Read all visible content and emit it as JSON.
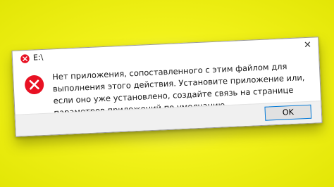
{
  "window": {
    "title": "E:\\",
    "close_glyph": "✕"
  },
  "icons": {
    "title_icon": "error-icon",
    "message_icon": "error-icon",
    "error_color": "#e81123"
  },
  "message": {
    "text": "Нет приложения, сопоставленного с этим файлом для выполнения этого действия. Установите приложение или, если оно уже установлено, создайте связь на странице параметров приложений по умолчанию."
  },
  "buttons": {
    "ok_label": "OK"
  }
}
